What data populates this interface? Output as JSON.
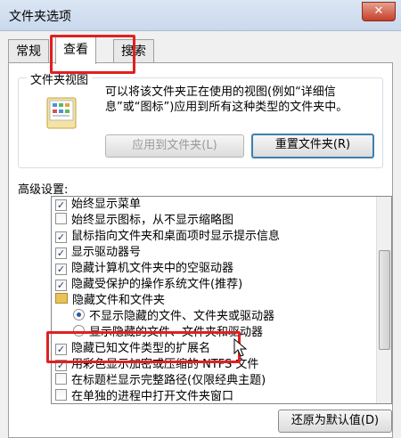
{
  "window": {
    "title": "文件夹选项",
    "close_icon": "close-icon"
  },
  "tabs": [
    {
      "label": "常规"
    },
    {
      "label": "查看"
    },
    {
      "label": "搜索"
    }
  ],
  "folder_views": {
    "title": "文件夹视图",
    "description": "可以将该文件夹正在使用的视图(例如“详细信息”或“图标”)应用到所有这种类型的文件夹中。",
    "apply_button": "应用到文件夹(L)",
    "reset_button": "重置文件夹(R)"
  },
  "advanced": {
    "label": "高级设置:",
    "items": [
      {
        "type": "checkbox",
        "checked": true,
        "label": "始终显示菜单"
      },
      {
        "type": "checkbox",
        "checked": false,
        "label": "始终显示图标，从不显示缩略图"
      },
      {
        "type": "checkbox",
        "checked": true,
        "label": "鼠标指向文件夹和桌面项时显示提示信息"
      },
      {
        "type": "checkbox",
        "checked": true,
        "label": "显示驱动器号"
      },
      {
        "type": "checkbox",
        "checked": true,
        "label": "隐藏计算机文件夹中的空驱动器"
      },
      {
        "type": "checkbox",
        "checked": true,
        "label": "隐藏受保护的操作系统文件(推荐)"
      },
      {
        "type": "folder",
        "label": "隐藏文件和文件夹"
      },
      {
        "type": "radio",
        "checked": true,
        "label": "不显示隐藏的文件、文件夹或驱动器"
      },
      {
        "type": "radio",
        "checked": false,
        "label": "显示隐藏的文件、文件夹和驱动器"
      },
      {
        "type": "checkbox",
        "checked": true,
        "label": "隐藏已知文件类型的扩展名"
      },
      {
        "type": "checkbox",
        "checked": true,
        "label": "用彩色显示加密或压缩的 NTFS 文件"
      },
      {
        "type": "checkbox",
        "checked": false,
        "label": "在标题栏显示完整路径(仅限经典主题)"
      },
      {
        "type": "checkbox",
        "checked": false,
        "label": "在单独的进程中打开文件夹窗口"
      }
    ],
    "restore_button": "还原为默认值(D)"
  },
  "colors": {
    "highlight": "#e02020",
    "accent": "#3c7fb1"
  }
}
